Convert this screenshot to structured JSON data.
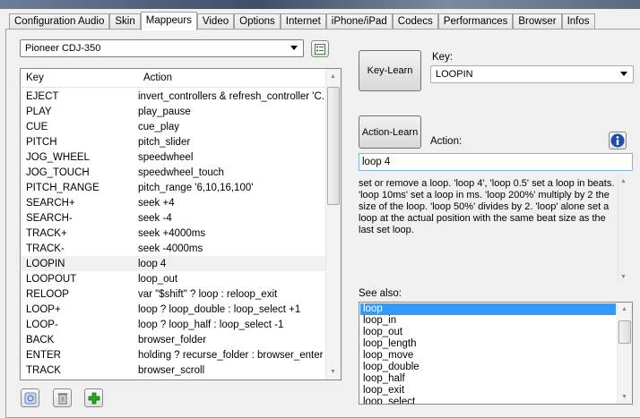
{
  "tabs": [
    "Configuration Audio",
    "Skin",
    "Mappeurs",
    "Video",
    "Options",
    "Internet",
    "iPhone/iPad",
    "Codecs",
    "Performances",
    "Browser",
    "Infos"
  ],
  "active_tab": "Mappeurs",
  "mapper_select": {
    "value": "Pioneer CDJ-350"
  },
  "table": {
    "headers": [
      "Key",
      "Action"
    ],
    "rows": [
      {
        "key": "EJECT",
        "action": "invert_controllers & refresh_controller 'C..."
      },
      {
        "key": "PLAY",
        "action": "play_pause"
      },
      {
        "key": "CUE",
        "action": "cue_play"
      },
      {
        "key": "PITCH",
        "action": "pitch_slider"
      },
      {
        "key": "JOG_WHEEL",
        "action": "speedwheel"
      },
      {
        "key": "JOG_TOUCH",
        "action": "speedwheel_touch"
      },
      {
        "key": "PITCH_RANGE",
        "action": "pitch_range '6,10,16,100'"
      },
      {
        "key": "SEARCH+",
        "action": "seek +4"
      },
      {
        "key": "SEARCH-",
        "action": "seek -4"
      },
      {
        "key": "TRACK+",
        "action": "seek +4000ms"
      },
      {
        "key": "TRACK-",
        "action": "seek -4000ms"
      },
      {
        "key": "LOOPIN",
        "action": "loop 4"
      },
      {
        "key": "LOOPOUT",
        "action": "loop_out"
      },
      {
        "key": "RELOOP",
        "action": "var \"$shift\" ? loop : reloop_exit"
      },
      {
        "key": "LOOP+",
        "action": "loop ? loop_double : loop_select +1"
      },
      {
        "key": "LOOP-",
        "action": "loop ? loop_half : loop_select -1"
      },
      {
        "key": "BACK",
        "action": "browser_folder"
      },
      {
        "key": "ENTER",
        "action": "holding ? recurse_folder : browser_enter"
      },
      {
        "key": "TRACK",
        "action": "browser_scroll"
      }
    ],
    "selected_index": 11
  },
  "key_learn_label": "Key-Learn",
  "key_label": "Key:",
  "key_value": "LOOPIN",
  "action_learn_label": "Action-Learn",
  "action_label": "Action:",
  "action_value": "loop 4",
  "description": "set or remove a loop. 'loop 4', 'loop 0.5' set a loop in beats. 'loop 10ms' set a loop in ms. 'loop 200%' multiply by 2 the size of the loop. 'loop 50%' divides by 2. 'loop' alone set a loop at the actual position with the same beat size as the last set loop.",
  "see_also_label": "See also:",
  "see_also": [
    "loop",
    "loop_in",
    "loop_out",
    "loop_length",
    "loop_move",
    "loop_double",
    "loop_half",
    "loop_exit",
    "loop_select"
  ],
  "colors": {
    "selection": "#3399ff",
    "add": "#22aa22",
    "info": "#1a4fa8"
  }
}
